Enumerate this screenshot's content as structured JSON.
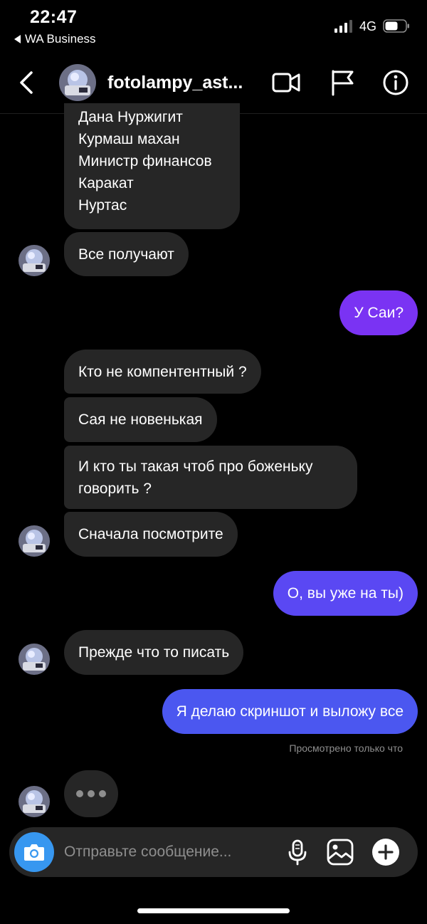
{
  "status_bar": {
    "time": "22:47",
    "back_app": "WA Business",
    "network": "4G"
  },
  "header": {
    "username": "fotolampy_ast...",
    "icons": [
      "back-chevron-icon",
      "video-call-icon",
      "flag-icon",
      "info-icon"
    ]
  },
  "messages": {
    "m1": "Дана Нуржигит\nКурмаш махан\nМинистр финансов\nКаракат\nНуртас",
    "m2": "Все получают",
    "m3": "У Саи?",
    "m4": "Кто не компентентный ?",
    "m5": "Сая не новенькая",
    "m6": "И кто ты такая чтоб про боженьку\nговорить ?",
    "m7": "Сначала посмотрите",
    "m8": "О, вы уже на ты)",
    "m9": "Прежде что то писать",
    "m10": "Я делаю скриншот и выложу все"
  },
  "seen_status": "Просмотрено только что",
  "composer": {
    "placeholder": "Отправьте сообщение...",
    "icons": [
      "camera-icon",
      "microphone-icon",
      "gallery-icon",
      "plus-icon"
    ]
  },
  "colors": {
    "incoming_bubble": "#262626",
    "outgoing_gradient": [
      "#7b2ff7",
      "#4a55f2"
    ],
    "camera_button": "#3797f0"
  }
}
